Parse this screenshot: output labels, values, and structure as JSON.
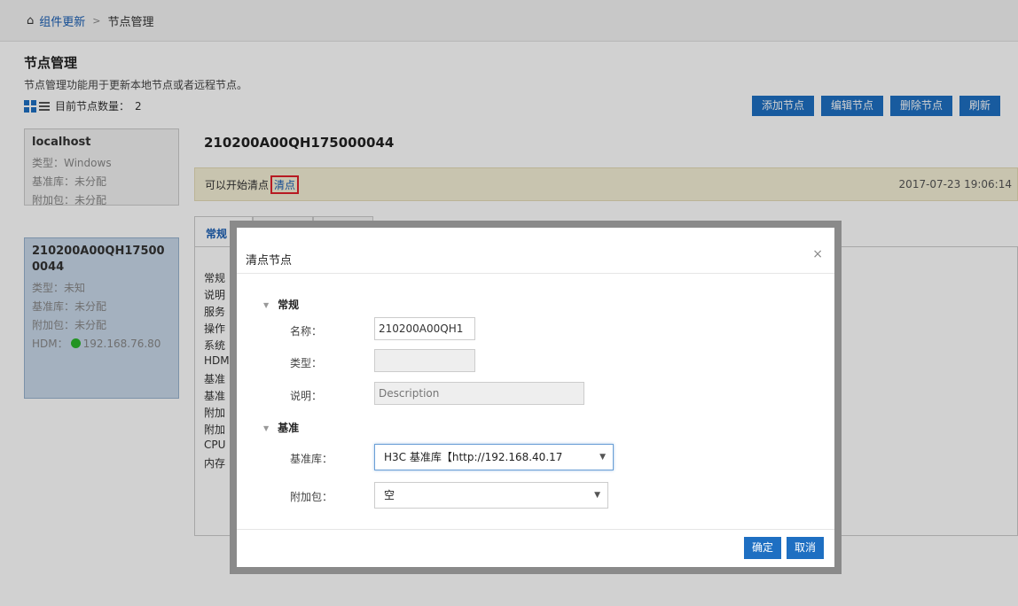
{
  "breadcrumb": {
    "home_icon": "home-icon",
    "parent": "组件更新",
    "separator": ">",
    "current": "节点管理"
  },
  "page": {
    "title": "节点管理",
    "description": "节点管理功能用于更新本地节点或者远程节点。",
    "node_count_label": "目前节点数量：",
    "node_count": "2"
  },
  "actions": {
    "add": "添加节点",
    "edit": "编辑节点",
    "delete": "删除节点",
    "refresh": "刷新"
  },
  "nodes": [
    {
      "name": "localhost",
      "type": "类型：Windows",
      "baseline": "基准库：未分配",
      "addon": "附加包：未分配"
    },
    {
      "name": "210200A00QH175000044",
      "type": "类型：未知",
      "baseline": "基准库：未分配",
      "addon": "附加包：未分配",
      "hdm_label": "HDM：",
      "hdm_ip": "192.168.76.80"
    }
  ],
  "detail": {
    "title": "210200A00QH175000044",
    "notice_text": "可以开始清点",
    "notice_link": "清点",
    "timestamp": "2017-07-23 19:06:14",
    "tabs": [
      "常规",
      "",
      ""
    ],
    "labels": [
      "常规",
      "说明",
      "服务",
      "操作",
      "系统",
      "HDM",
      "基准",
      "基准",
      "附加",
      "附加",
      "CPU",
      "内存"
    ]
  },
  "modal": {
    "title": "清点节点",
    "close": "×",
    "section_general": "常规",
    "name_label": "名称：",
    "name_value": "210200A00QH1",
    "type_label": "类型：",
    "type_value": "",
    "desc_label": "说明：",
    "desc_placeholder": "Description",
    "section_baseline": "基准",
    "baseline_label": "基准库：",
    "baseline_value": "H3C 基准库【http://192.168.40.17",
    "addon_label": "附加包：",
    "addon_value": "空",
    "ok": "确定",
    "cancel": "取消"
  }
}
